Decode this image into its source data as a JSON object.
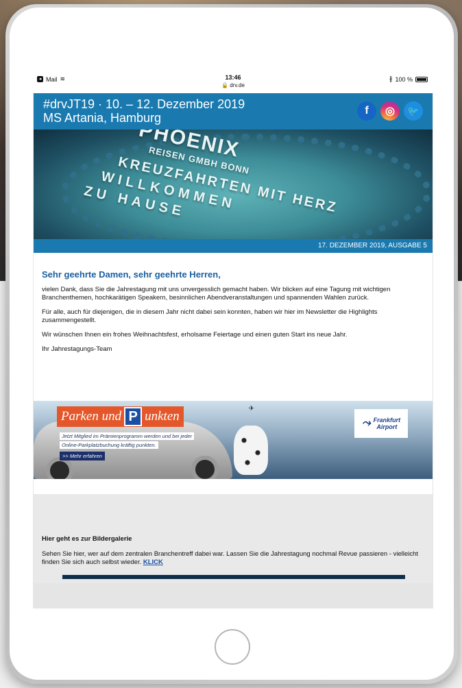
{
  "statusbar": {
    "app": "Mail",
    "time": "13:46",
    "url": "drv.de",
    "battery": "100 %"
  },
  "header": {
    "title_line1": "#drvJT19 · 10. – 12. Dezember 2019",
    "title_line2": "MS Artania, Hamburg",
    "social_icons": [
      "facebook-icon",
      "instagram-icon",
      "twitter-icon"
    ],
    "background_color": "#1a7ab0"
  },
  "hero": {
    "cake_line1": "PHOENIX",
    "cake_line2": "REISEN GMBH BONN",
    "cake_line3": "KREUZFAHRTEN MIT HERZ",
    "cake_line4": "WILLKOMMEN",
    "cake_line5": "ZU HAUSE"
  },
  "issue": {
    "label": "17. DEZEMBER 2019, AUSGABE 5"
  },
  "letter": {
    "greeting": "Sehr geehrte Damen, sehr geehrte Herren,",
    "p1": "vielen Dank, dass Sie die Jahrestagung mit uns unvergesslich gemacht haben. Wir blicken auf eine Tagung mit wichtigen Branchenthemen, hochkarätigen Speakern, besinnlichen Abendveranstaltungen und spannenden Wahlen zurück.",
    "p2": "Für alle, auch für diejenigen, die in diesem Jahr nicht dabei sein konnten, haben wir hier im Newsletter die Highlights zusammengestellt.",
    "p3": "Wir wünschen Ihnen ein frohes Weihnachtsfest, erholsame Feiertage und einen guten Start ins neue Jahr.",
    "signature": "Ihr Jahrestagungs-Team"
  },
  "ad": {
    "title_part1": "Parken und",
    "title_p": "P",
    "title_part2": "unkten",
    "sub1": "Jetzt Mitglied im Prämienprogramm werden und bei jeder",
    "sub2": "Online-Parkplatzbuchung kräftig punkten.",
    "more": ">> Mehr erfahren",
    "logo_line1": "Frankfurt",
    "logo_line2": "Airport"
  },
  "gallery": {
    "heading": "Hier geht es zur Bildergalerie",
    "text": "Sehen Sie hier, wer auf dem zentralen Branchentreff dabei war. Lassen Sie die Jahrestagung nochmal Revue passieren - vielleicht finden Sie sich auch selbst wieder.",
    "link": "KLICK"
  }
}
